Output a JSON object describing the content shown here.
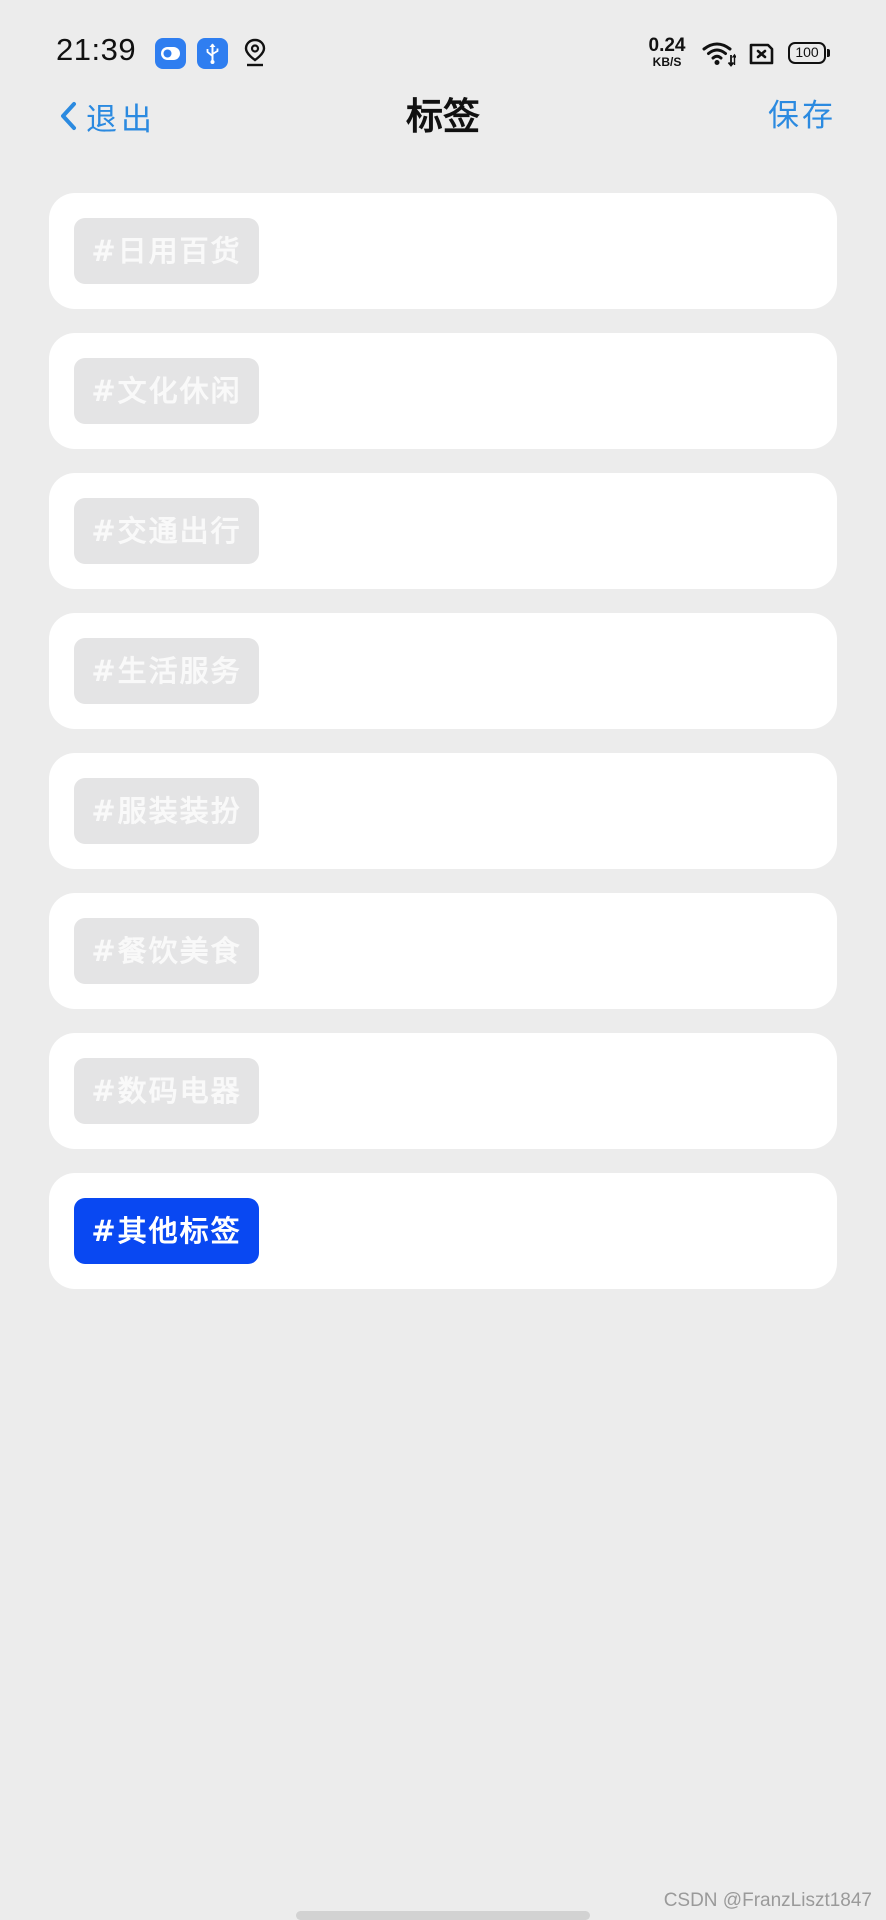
{
  "status_bar": {
    "time": "21:39",
    "net_speed_value": "0.24",
    "net_speed_unit": "KB/S",
    "battery": "100",
    "icons": [
      "app-notification-icon",
      "usb-icon",
      "location-icon",
      "wifi-icon",
      "no-sim-icon",
      "battery-icon"
    ]
  },
  "nav": {
    "back_label": "退出",
    "title": "标签",
    "save_label": "保存"
  },
  "tags": [
    {
      "label": "#日用百货",
      "selected": false
    },
    {
      "label": "#文化休闲",
      "selected": false
    },
    {
      "label": "#交通出行",
      "selected": false
    },
    {
      "label": "#生活服务",
      "selected": false
    },
    {
      "label": "#服装装扮",
      "selected": false
    },
    {
      "label": "#餐饮美食",
      "selected": false
    },
    {
      "label": "#数码电器",
      "selected": false
    },
    {
      "label": "#其他标签",
      "selected": true
    }
  ],
  "watermark": "CSDN @FranzLiszt1847",
  "colors": {
    "background": "#ececec",
    "accent": "#2b8ae0",
    "selected_chip": "#0948f2",
    "unselected_chip": "#e4e4e5"
  }
}
